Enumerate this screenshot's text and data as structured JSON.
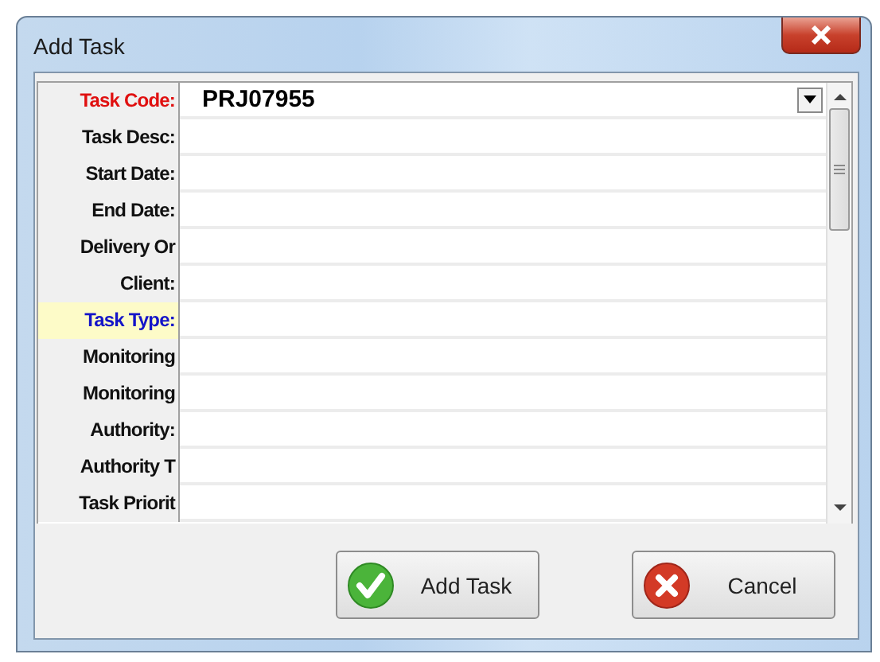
{
  "window": {
    "title": "Add Task"
  },
  "rows": [
    {
      "label": "Task Code:",
      "required": true,
      "selected": false,
      "value": "PRJ07955",
      "dropdown": true
    },
    {
      "label": "Task Desc:",
      "required": false,
      "selected": false,
      "dropdown": false
    },
    {
      "label": "Start Date:",
      "required": false,
      "selected": false,
      "dropdown": false
    },
    {
      "label": "End Date:",
      "required": false,
      "selected": false,
      "dropdown": false
    },
    {
      "label": "Delivery Or",
      "required": false,
      "selected": false,
      "dropdown": false
    },
    {
      "label": "Client:",
      "required": false,
      "selected": false,
      "dropdown": false
    },
    {
      "label": "Task Type:",
      "required": false,
      "selected": true,
      "dropdown": false
    },
    {
      "label": "Monitoring",
      "required": false,
      "selected": false,
      "dropdown": false
    },
    {
      "label": "Monitoring",
      "required": false,
      "selected": false,
      "dropdown": false
    },
    {
      "label": "Authority:",
      "required": false,
      "selected": false,
      "dropdown": false
    },
    {
      "label": "Authority T",
      "required": false,
      "selected": false,
      "dropdown": false
    },
    {
      "label": "Task Priorit",
      "required": false,
      "selected": false,
      "dropdown": false
    }
  ],
  "buttons": [
    {
      "kind": "confirm",
      "label": "Add Task"
    },
    {
      "kind": "cancel",
      "label": "Cancel"
    }
  ]
}
